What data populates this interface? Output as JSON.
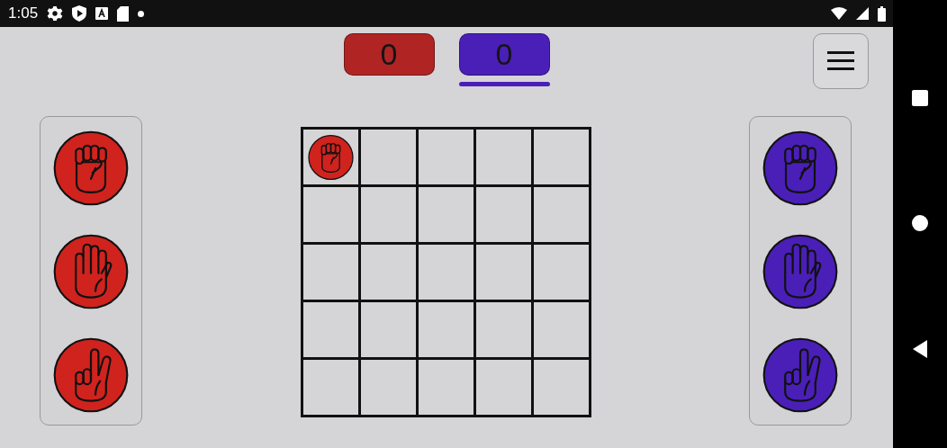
{
  "status_bar": {
    "time": "1:05"
  },
  "scores": [
    {
      "value": "0",
      "color": "#b02424",
      "selected": false
    },
    {
      "value": "0",
      "color": "#4a1fb8",
      "selected": true
    }
  ],
  "hands": [
    {
      "color": "#d0231e",
      "pieces": [
        {
          "kind": "rock"
        },
        {
          "kind": "paper"
        },
        {
          "kind": "scissors"
        }
      ]
    },
    {
      "color": "#4a1fb8",
      "pieces": [
        {
          "kind": "rock"
        },
        {
          "kind": "paper"
        },
        {
          "kind": "scissors"
        }
      ]
    }
  ],
  "board": {
    "rows": [
      [
        {
          "kind": "rock",
          "color": "#d0231e"
        },
        null,
        null,
        null,
        null
      ],
      [
        null,
        null,
        null,
        null,
        null
      ],
      [
        null,
        null,
        null,
        null,
        null
      ],
      [
        null,
        null,
        null,
        null,
        null
      ],
      [
        null,
        null,
        null,
        null,
        null
      ]
    ]
  }
}
